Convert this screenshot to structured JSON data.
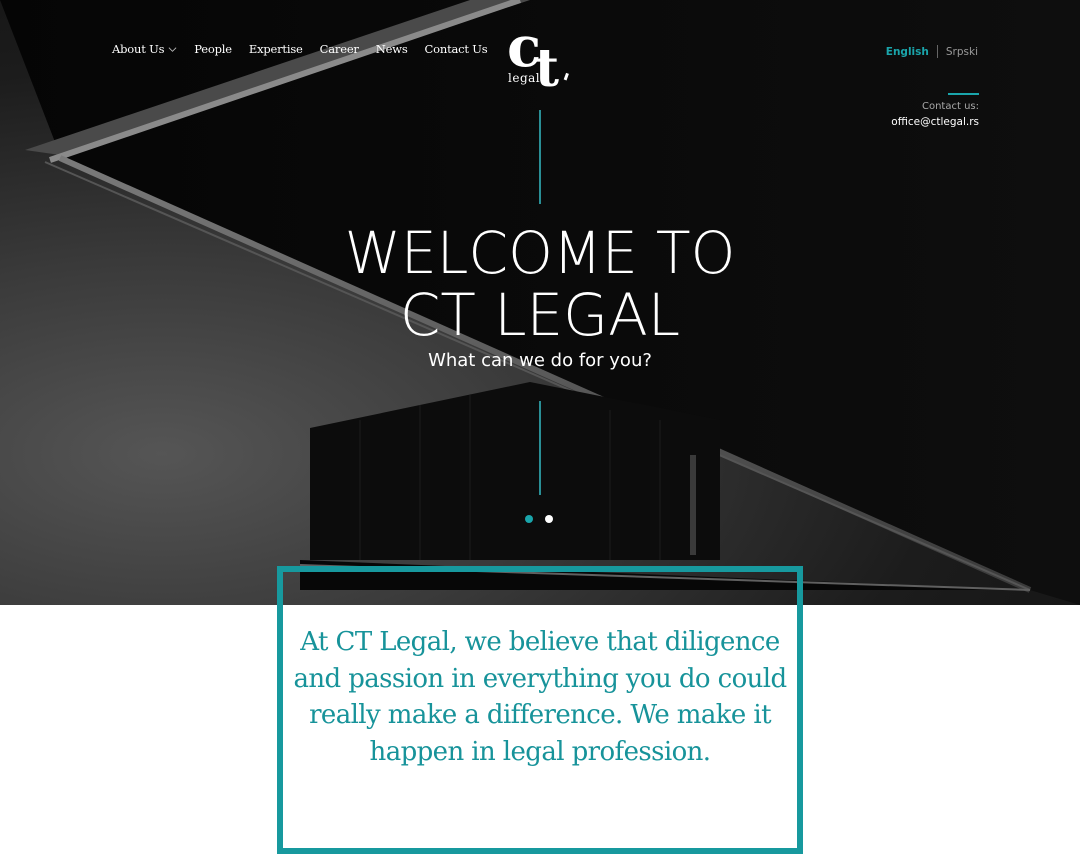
{
  "nav": {
    "items": [
      {
        "label": "About Us",
        "has_dropdown": true
      },
      {
        "label": "People",
        "has_dropdown": false
      },
      {
        "label": "Expertise",
        "has_dropdown": false
      },
      {
        "label": "Career",
        "has_dropdown": false
      },
      {
        "label": "News",
        "has_dropdown": false
      },
      {
        "label": "Contact Us",
        "has_dropdown": false
      }
    ]
  },
  "logo": {
    "mark": "ct",
    "sub": "legal"
  },
  "language": {
    "active": "English",
    "other": "Srpski"
  },
  "contact": {
    "label": "Contact us:",
    "email": "office@ctlegal.rs"
  },
  "hero": {
    "title_line1": "WELCOME TO",
    "title_line2": "CT LEGAL",
    "subtitle": "What can we do for you?",
    "slides_total": 2,
    "active_slide": 1
  },
  "mission": {
    "text": "At CT Legal, we believe that diligence and passion in everything you do could really make a difference. We make it happen in legal profession."
  },
  "colors": {
    "accent": "#1aa5ab",
    "accent_dark": "#17999e",
    "hero_bg": "#0d0d0d",
    "text_light": "#ffffff"
  }
}
